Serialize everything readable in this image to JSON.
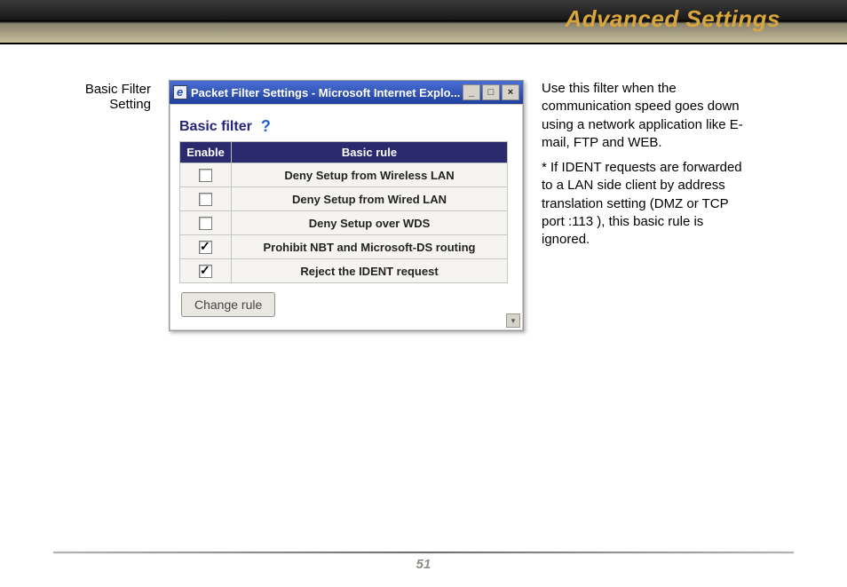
{
  "header": {
    "title": "Advanced Settings"
  },
  "leftLabel": {
    "line1": "Basic Filter",
    "line2": "Setting"
  },
  "window": {
    "title": "Packet Filter Settings - Microsoft Internet Explo...",
    "section": "Basic filter",
    "table": {
      "headers": {
        "enable": "Enable",
        "rule": "Basic rule"
      },
      "rows": [
        {
          "checked": false,
          "label": "Deny Setup from Wireless LAN"
        },
        {
          "checked": false,
          "label": "Deny Setup from Wired LAN"
        },
        {
          "checked": false,
          "label": "Deny Setup over WDS"
        },
        {
          "checked": true,
          "label": "Prohibit NBT and Microsoft-DS routing"
        },
        {
          "checked": true,
          "label": "Reject the IDENT request"
        }
      ]
    },
    "button": "Change rule"
  },
  "description": {
    "p1": "Use this filter when the communication speed goes down using a network application like E-mail, FTP and WEB.",
    "p2": "* If IDENT requests are forwarded to a LAN side client by address translation setting (DMZ or TCP port :113 ), this basic rule is ignored."
  },
  "footer": {
    "pageNumber": "51"
  }
}
